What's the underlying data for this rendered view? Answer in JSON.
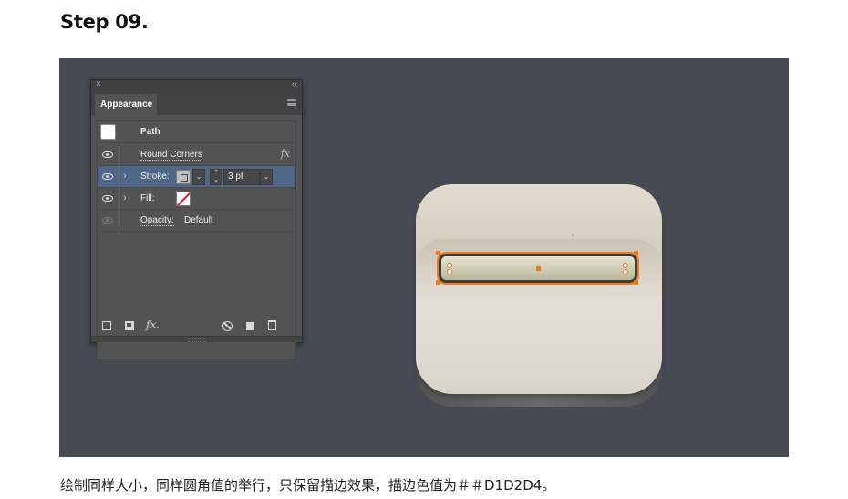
{
  "step_title": "Step 09.",
  "caption": "绘制同样大小，同样圆角值的举行，只保留描边效果，描边色值为＃＃D1D2D4。",
  "panel": {
    "close_glyph": "×",
    "collapse_glyph": "‹‹",
    "tab_label": "Appearance",
    "rows": [
      {
        "label": "Path",
        "type": "header"
      },
      {
        "label": "Round Corners",
        "visible": true,
        "fx": "fx"
      },
      {
        "label": "Stroke:",
        "visible": true,
        "expand": "›",
        "selected": true,
        "weight": "3 pt"
      },
      {
        "label": "Fill:",
        "visible": true,
        "expand": "›"
      },
      {
        "label": "Opacity:",
        "value": "Default",
        "visible": false
      }
    ],
    "bottom_icons": [
      "add-stroke-icon",
      "add-fill-icon",
      "fx-icon",
      "clear-appearance-icon",
      "duplicate-item-icon",
      "delete-item-icon"
    ],
    "fx_glyph": "fx."
  },
  "colors": {
    "stage_bg": "#464a52",
    "selection_row": "#4e6787",
    "anchor_orange": "#f07a22",
    "fill_red_slash": "#d21f2a"
  }
}
